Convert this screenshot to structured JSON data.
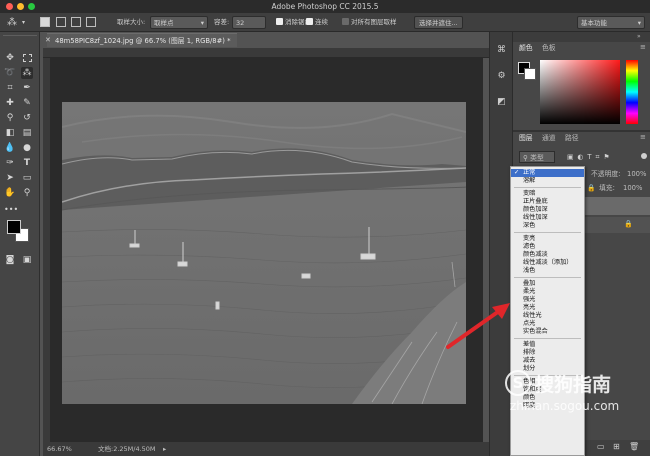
{
  "app": {
    "title": "Adobe Photoshop CC 2015.5",
    "traffic_colors": [
      "#ff5f57",
      "#ffbd2e",
      "#28c940"
    ]
  },
  "options_bar": {
    "sample_size_label": "取样大小:",
    "sample_size_value": "取样点",
    "tolerance_label": "容差:",
    "tolerance_value": "32",
    "antialias_label": "消除锯齿",
    "contiguous_label": "连续",
    "all_layers_label": "对所有图层取样",
    "select_subject_button": "选择并遮住...",
    "workspace_value": "基本功能"
  },
  "document": {
    "tab_title": "48m58PIC8zf_1024.jpg @ 66.7% (图层 1, RGB/8#) *",
    "zoom": "66.67%",
    "doc_size": "文档:2.25M/4.50M"
  },
  "toolbar": {
    "icons": [
      "move-icon",
      "marquee-icon",
      "lasso-icon",
      "magic-wand-icon",
      "crop-icon",
      "eyedropper-icon",
      "healing-icon",
      "brush-icon",
      "clone-stamp-icon",
      "history-brush-icon",
      "eraser-icon",
      "gradient-icon",
      "blur-icon",
      "dodge-icon",
      "pen-icon",
      "type-icon",
      "path-select-icon",
      "shape-icon",
      "hand-icon",
      "zoom-icon"
    ]
  },
  "color_panel": {
    "tabs": [
      "颜色",
      "色板"
    ]
  },
  "layers_panel": {
    "tabs": [
      "图层",
      "通道",
      "路径"
    ],
    "filter_kind": "类型",
    "opacity_label": "不透明度:",
    "opacity_value": "100%",
    "fill_label": "填充:",
    "fill_value": "100%"
  },
  "blend_modes": {
    "selected": "正常",
    "groups": [
      [
        "正常",
        "溶解"
      ],
      [
        "变暗",
        "正片叠底",
        "颜色加深",
        "线性加深",
        "深色"
      ],
      [
        "变亮",
        "滤色",
        "颜色减淡",
        "线性减淡（添加）",
        "浅色"
      ],
      [
        "叠加",
        "柔光",
        "强光",
        "亮光",
        "线性光",
        "点光",
        "实色混合"
      ],
      [
        "差值",
        "排除",
        "减去",
        "划分"
      ],
      [
        "色相",
        "饱和度",
        "颜色",
        "明度"
      ]
    ]
  },
  "watermark": {
    "brand": "搜狗指南",
    "url": "zhinan.sogou.com"
  },
  "annotation": {
    "arrow_color": "#e0262a"
  }
}
